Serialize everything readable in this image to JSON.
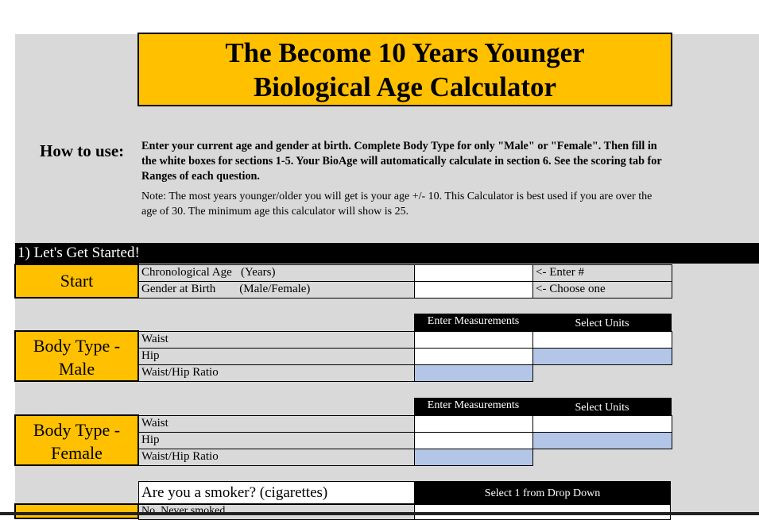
{
  "title": {
    "line1": "The Become 10 Years Younger",
    "line2": "Biological Age Calculator"
  },
  "how_to_use": {
    "label": "How to use:",
    "instructions": "Enter your current age and gender at birth. Complete Body Type for only \"Male\" or \"Female\". Then fill in the white boxes for sections 1-5. Your BioAge will automatically calculate in section 6.  See the scoring tab for Ranges of each question.",
    "note": "Note: The most years younger/older you will get is your age +/- 10.  This Calculator is best used if you are over the age of 30. The minimum age this calculator will show is 25."
  },
  "section1": {
    "header": "1) Let's Get Started!",
    "block_label": "Start",
    "rows": [
      {
        "label": "Chronological Age   (Years)",
        "value": "",
        "hint": "<- Enter #"
      },
      {
        "label": "Gender at Birth        (Male/Female)",
        "value": "",
        "hint": "<- Choose one"
      }
    ]
  },
  "body_male": {
    "block_label_line1": "Body Type -",
    "block_label_line2": "Male",
    "col_measure": "Enter Measurements",
    "col_units": "Select Units",
    "rows": [
      {
        "label": "Waist",
        "measurement": "",
        "units": ""
      },
      {
        "label": "Hip",
        "measurement": "",
        "units": ""
      },
      {
        "label": "Waist/Hip Ratio",
        "measurement": ""
      }
    ]
  },
  "body_female": {
    "block_label_line1": "Body Type -",
    "block_label_line2": "Female",
    "col_measure": "Enter Measurements",
    "col_units": "Select Units",
    "rows": [
      {
        "label": "Waist",
        "measurement": "",
        "units": ""
      },
      {
        "label": "Hip",
        "measurement": "",
        "units": ""
      },
      {
        "label": "Waist/Hip Ratio",
        "measurement": ""
      }
    ]
  },
  "smoker": {
    "question": "Are you a smoker? (cigarettes)",
    "dropdown_header": "Select 1 from Drop Down",
    "first_option": "No, Never smoked",
    "selected": ""
  },
  "colors": {
    "gold": "#ffc000",
    "sheet_gray": "#d9d9d9",
    "calc_blue": "#b4c6e7",
    "header_black": "#000000"
  }
}
